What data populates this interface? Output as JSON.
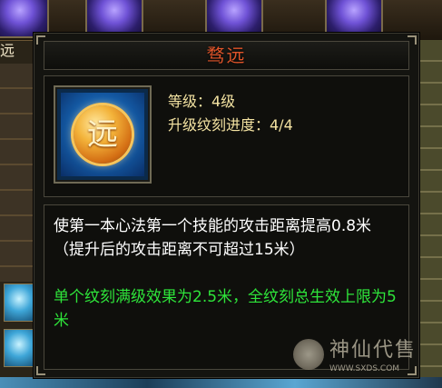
{
  "background": {
    "left_label": "远"
  },
  "tooltip": {
    "title": "骛远",
    "skill_icon": {
      "glyph": "远",
      "icon": "coin-skill-icon"
    },
    "level_text": "等级：4级",
    "progress_text": "升级纹刻进度：4/4",
    "description_main": "使第一本心法第一个技能的攻击距离提高0.8米（提升后的攻击距离不可超过15米）",
    "description_bonus": "单个纹刻满级效果为2.5米，全纹刻总生效上限为5米"
  },
  "watermark": {
    "brand": "神仙代售",
    "url": "WWW.SXDS.COM"
  },
  "colors": {
    "title": "#e0552a",
    "stat": "#f4e3a2",
    "desc_main": "#ffffff",
    "desc_bonus": "#2ee43a"
  }
}
